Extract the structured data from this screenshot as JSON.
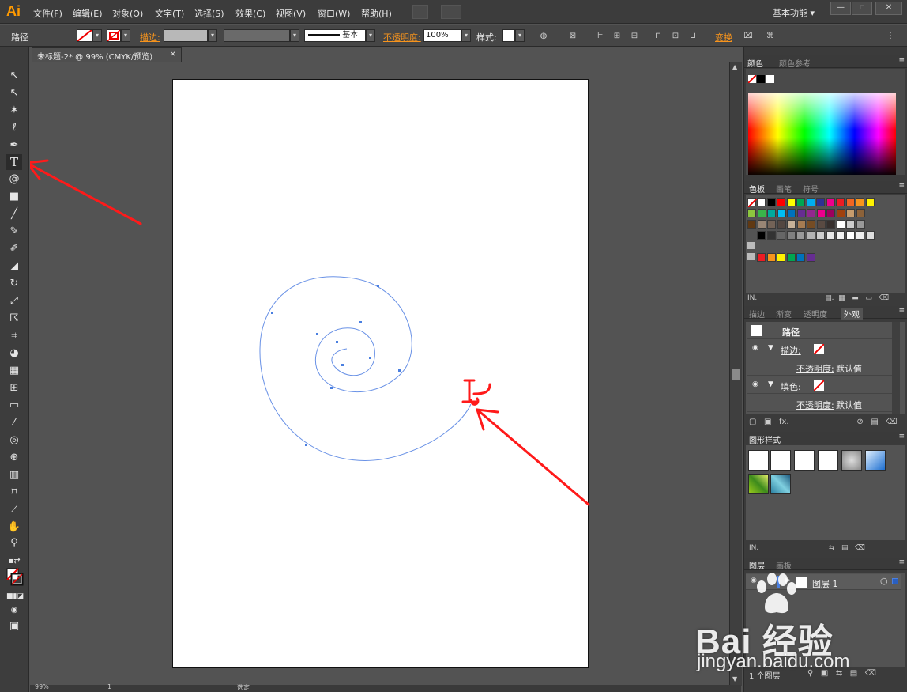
{
  "app": {
    "logo": "Ai",
    "workspace": "基本功能 ▾",
    "win_min": "—",
    "win_max": "▫",
    "win_close": "✕"
  },
  "menu": [
    "文件(F)",
    "编辑(E)",
    "对象(O)",
    "文字(T)",
    "选择(S)",
    "效果(C)",
    "视图(V)",
    "窗口(W)",
    "帮助(H)"
  ],
  "control": {
    "object_type": "路径",
    "stroke_label": "描边:",
    "style_basic": "基本",
    "opacity_label": "不透明度:",
    "opacity_value": "100%",
    "style_label": "样式:",
    "transform_label": "变换"
  },
  "document": {
    "tab_title": "未标题-2* @ 99% (CMYK/预览)",
    "close": "×"
  },
  "tools": [
    "selection-tool",
    "direct-selection-tool",
    "magic-wand-tool",
    "lasso-tool",
    "pen-tool",
    "type-tool",
    "spiral-tool",
    "rectangle-tool",
    "paintbrush-tool",
    "pencil-tool",
    "blob-brush-tool",
    "eraser-tool",
    "rotate-tool",
    "scale-tool",
    "warp-tool",
    "free-transform-tool",
    "shape-builder-tool",
    "perspective-grid-tool",
    "mesh-tool",
    "gradient-tool",
    "eyedropper-tool",
    "blend-tool",
    "symbol-sprayer-tool",
    "column-graph-tool",
    "artboard-tool",
    "slice-tool",
    "hand-tool",
    "zoom-tool"
  ],
  "tool_glyphs": {
    "type": "T"
  },
  "panels": {
    "color_tabs": [
      "颜色",
      "颜色参考"
    ],
    "swatch_tabs": [
      "色板",
      "画笔",
      "符号"
    ],
    "appearance_tabs": [
      "描边",
      "渐变",
      "透明度",
      "外观"
    ],
    "appearance": {
      "title": "路径",
      "rows": [
        {
          "label": "描边:",
          "orange": true
        },
        {
          "label": "不透明度:",
          "value": "默认值",
          "orange": true
        },
        {
          "label": "填色:",
          "orange": false
        },
        {
          "label": "不透明度:",
          "value": "默认值",
          "orange": true
        }
      ]
    },
    "graphic_styles_tab": "图形样式",
    "layers_tabs": [
      "图层",
      "画板"
    ],
    "layer_name": "图层 1",
    "layer_count": "1 个图层"
  },
  "status": {
    "zoom": "99%",
    "page": "1",
    "mode": "选定"
  },
  "swatch_colors": [
    [
      "#ffffff",
      "#000000",
      "#ff0000",
      "#ffff00",
      "#00a651",
      "#00aeef",
      "#2e3192",
      "#ec008c",
      "#ed1c24",
      "#f26522",
      "#f7941d",
      "#fff200"
    ],
    [
      "#8dc63f",
      "#39b54a",
      "#00a99d",
      "#00bff3",
      "#0072bc",
      "#662d91",
      "#92278f",
      "#ec008c",
      "#9e005d",
      "#a0410d",
      "#c69c6d",
      "#8c6239"
    ],
    [
      "#603913",
      "#998675",
      "#736357",
      "#534741",
      "#c7b299",
      "#a67c52",
      "#754c24",
      "#594a42",
      "#362f2d",
      "#ffffff",
      "#cccccc",
      "#999999"
    ],
    [
      "#000000",
      "#333333",
      "#666666",
      "#808080",
      "#999999",
      "#b3b3b3",
      "#cccccc",
      "#e6e6e6",
      "#f2f2f2",
      "#ffffff",
      "#eeeeee",
      "#dddddd"
    ],
    [
      "#ed1c24",
      "#f7941d",
      "#fff200",
      "#00a651",
      "#0072bc",
      "#662d91"
    ]
  ],
  "watermark": {
    "brand": "Bai  经验",
    "url": "jingyan.baidu.com"
  },
  "colors": {
    "accent": "#f7941d",
    "spiral": "#4a7fe0",
    "arrow": "#ff0000"
  }
}
